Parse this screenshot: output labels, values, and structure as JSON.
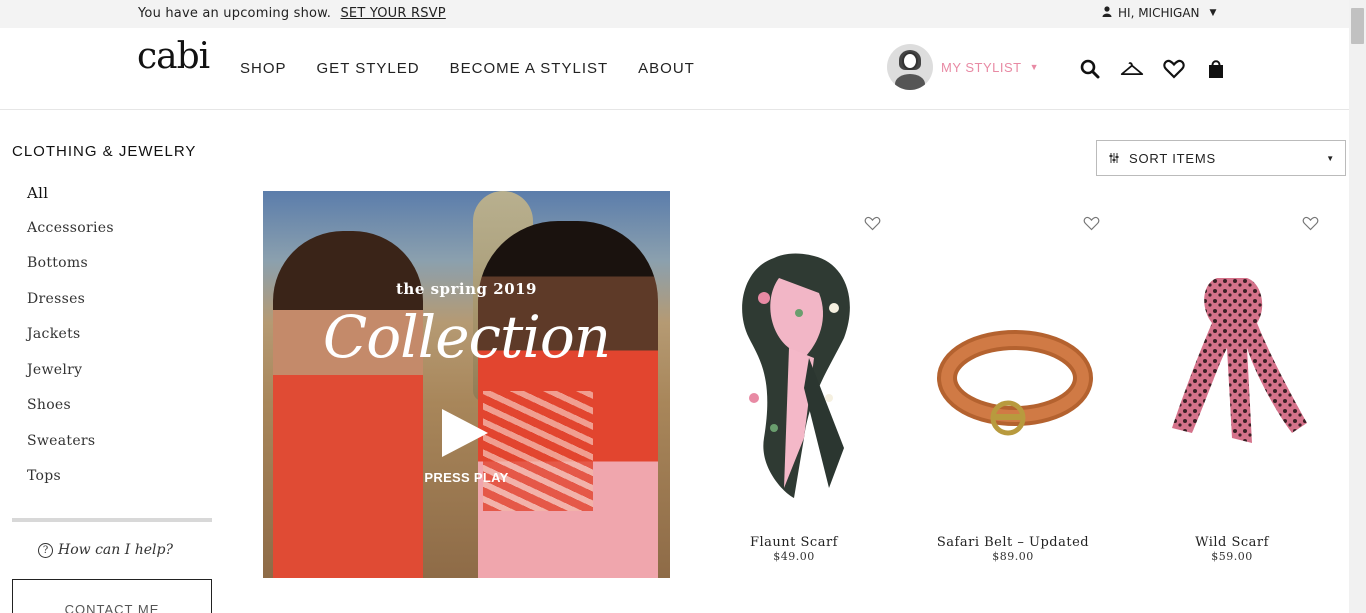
{
  "topbar": {
    "message": "You have an upcoming show.",
    "rsvp_link": "SET YOUR RSVP",
    "greeting": "HI, MICHIGAN"
  },
  "header": {
    "logo": "cabi",
    "nav": [
      "SHOP",
      "GET STYLED",
      "BECOME A STYLIST",
      "ABOUT"
    ],
    "stylist_label": "MY STYLIST",
    "icons": [
      "search-icon",
      "hanger-icon",
      "heart-icon",
      "bag-icon"
    ]
  },
  "sidebar": {
    "title": "CLOTHING & JEWELRY",
    "items": [
      "All",
      "Accessories",
      "Bottoms",
      "Dresses",
      "Jackets",
      "Jewelry",
      "Shoes",
      "Sweaters",
      "Tops"
    ],
    "help_text": "How can I help?",
    "contact_button": "CONTACT ME"
  },
  "sort": {
    "label": "SORT ITEMS"
  },
  "video": {
    "subtitle": "the spring 2019",
    "title": "Collection",
    "cta": "PRESS PLAY"
  },
  "products": [
    {
      "name": "Flaunt Scarf",
      "price": "$49.00"
    },
    {
      "name": "Safari Belt – Updated",
      "price": "$89.00"
    },
    {
      "name": "Wild Scarf",
      "price": "$59.00"
    }
  ],
  "colors": {
    "accent_pink": "#e88aa4",
    "topbar_bg": "#f3f3f3"
  }
}
